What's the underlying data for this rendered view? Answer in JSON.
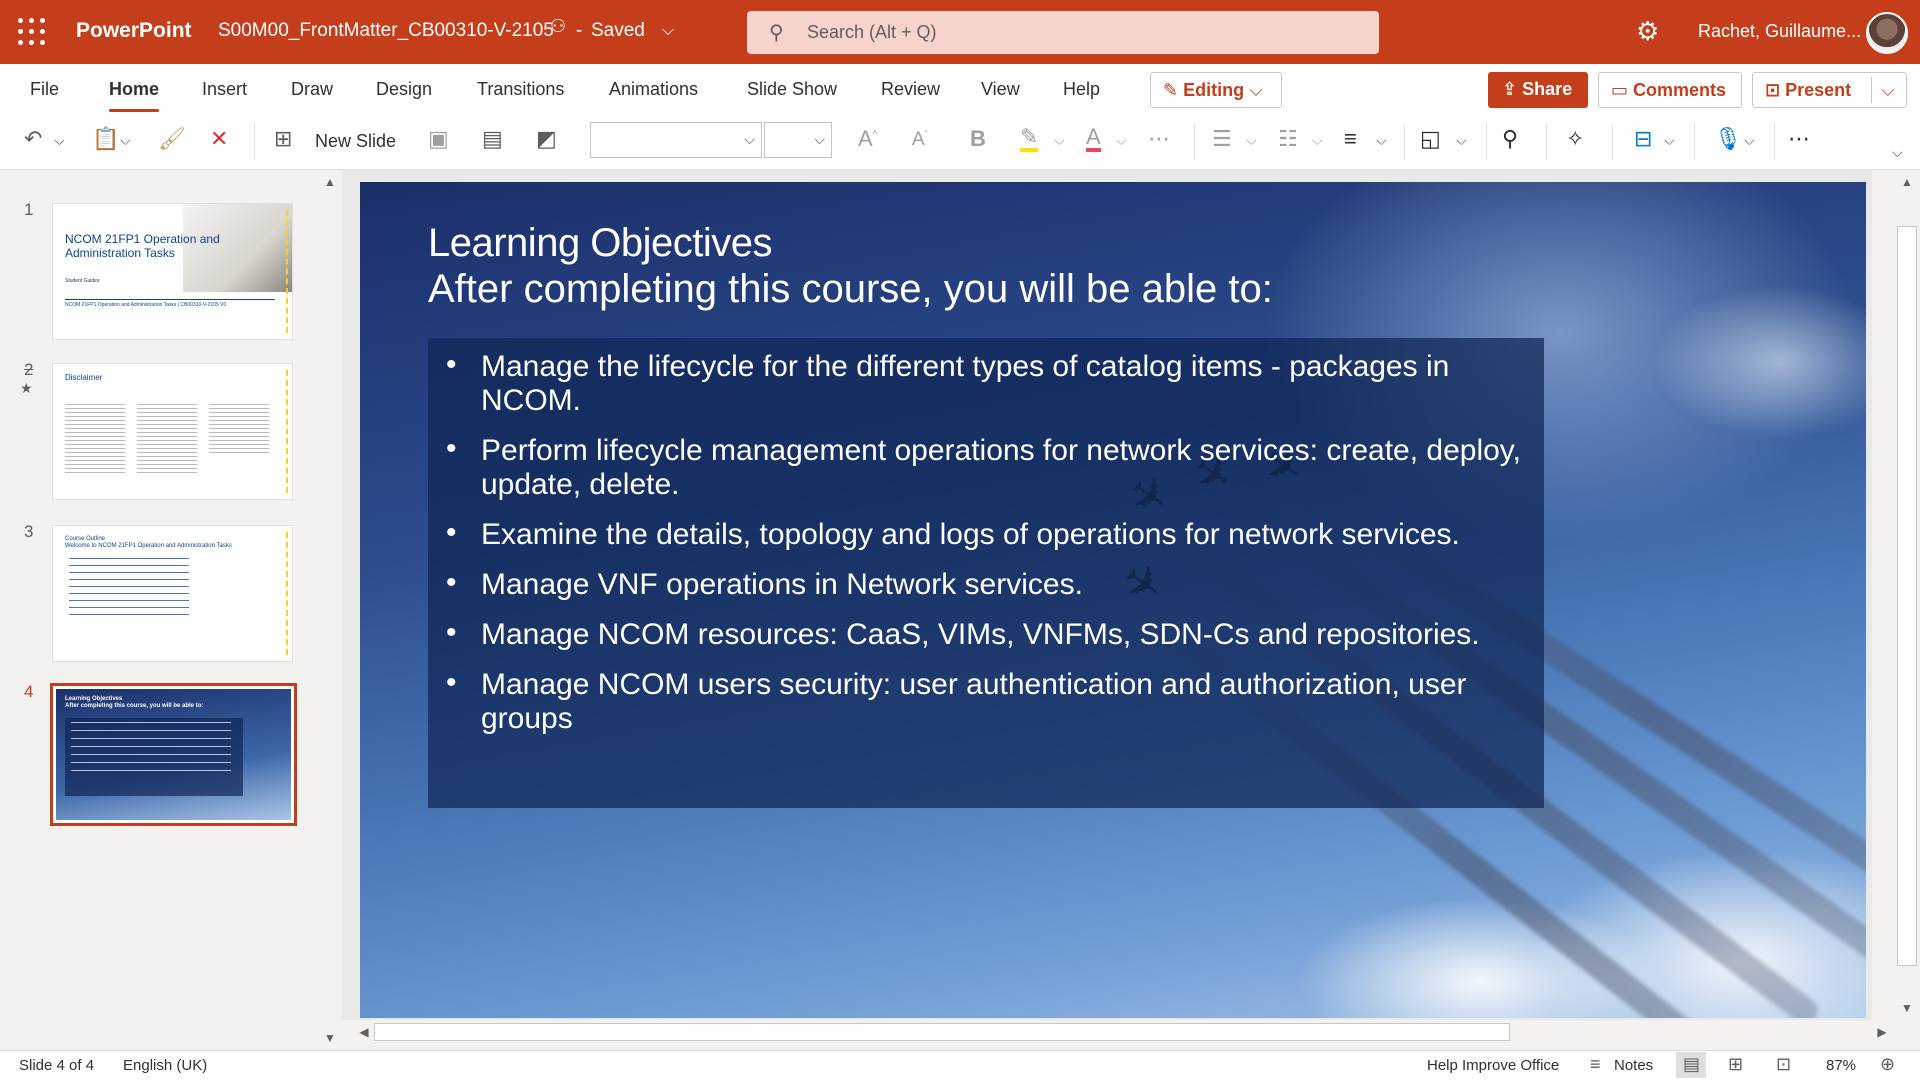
{
  "colors": {
    "brand": "#c43e1c",
    "search_bg": "#f6d4cb"
  },
  "titlebar": {
    "app_name": "PowerPoint",
    "doc_name": "S00M00_FrontMatter_CB00310-V-2105",
    "status": "Saved",
    "search_placeholder": "Search (Alt + Q)",
    "user": "Rachet, Guillaume..."
  },
  "tabs": [
    "File",
    "Home",
    "Insert",
    "Draw",
    "Design",
    "Transitions",
    "Animations",
    "Slide Show",
    "Review",
    "View",
    "Help"
  ],
  "active_tab": "Home",
  "right_buttons": {
    "editing": "Editing",
    "share": "Share",
    "comments": "Comments",
    "present": "Present"
  },
  "ribbon": {
    "new_slide": "New Slide",
    "icons": [
      "undo-icon",
      "paste-icon",
      "format-painter-icon",
      "delete-icon",
      "new-slide-icon",
      "reuse-slides-icon",
      "layout-icon",
      "background-icon",
      "font-name-box",
      "font-size-box",
      "grow-font-icon",
      "shrink-font-icon",
      "bold-icon",
      "highlight-icon",
      "font-color-icon",
      "more-font-icon",
      "bullets-icon",
      "numbering-icon",
      "align-icon",
      "shapes-icon",
      "find-icon",
      "designer-icon",
      "sensitivity-icon",
      "dictate-icon",
      "more-icon"
    ]
  },
  "thumbnails": [
    {
      "num": "1",
      "title": "NCOM 21FP1 Operation and Administration Tasks",
      "sub": "Student Guides",
      "foot": "NCOM 21FP1 Operation and Administration Tasks | CB00310-V-2105 V0"
    },
    {
      "num": "2",
      "title": "Disclaimer"
    },
    {
      "num": "3",
      "title": "Course Outline",
      "sub": "Welcome to NCOM 21FP1 Operation and Administration Tasks"
    },
    {
      "num": "4",
      "title": "Learning Objectives",
      "sub": "After completing this course, you will be able to:"
    }
  ],
  "slide": {
    "title_line1": "Learning Objectives",
    "title_line2": "After completing this course, you will be able to:",
    "bullets": [
      "Manage the lifecycle for the different types of catalog items - packages in NCOM.",
      "Perform lifecycle management operations for network services: create, deploy, update, delete.",
      "Examine the details, topology and logs of operations for network services.",
      "Manage VNF operations in Network services.",
      "Manage NCOM resources: CaaS, VIMs, VNFMs, SDN-Cs and repositories.",
      "Manage NCOM users security: user authentication and authorization, user groups"
    ]
  },
  "status": {
    "slide_pos": "Slide 4 of 4",
    "language": "English (UK)",
    "help": "Help Improve Office",
    "notes": "Notes",
    "zoom": "87%"
  }
}
